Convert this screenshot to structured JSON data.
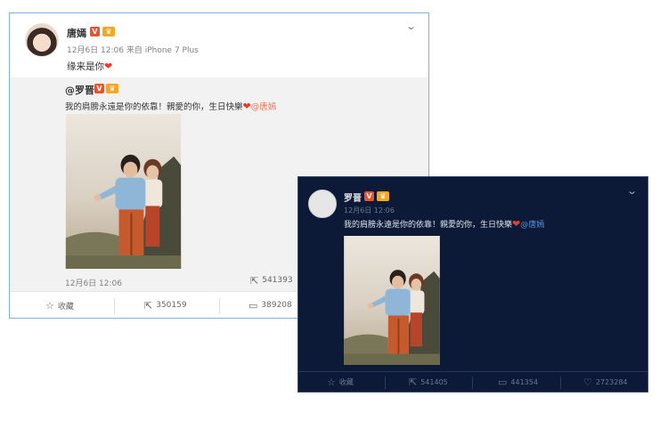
{
  "light_card": {
    "username": "唐嫣",
    "verified_badge": "V",
    "meta": "12月6日 12:06 来自 iPhone 7 Plus",
    "text": "缘来是你",
    "repost": {
      "username": "@罗晋",
      "text": "我的肩膀永遠是你的依靠！親愛的你，生日快樂",
      "mention": "@唐嫣",
      "date": "12月6日 12:06",
      "count": "541393"
    },
    "actions": [
      {
        "icon": "star-icon",
        "label": "收藏"
      },
      {
        "icon": "share-icon",
        "label": "350159"
      },
      {
        "icon": "comment-icon",
        "label": "389208"
      }
    ]
  },
  "dark_card": {
    "username": "罗晋",
    "verified_badge": "V",
    "meta": "12月6日 12:06",
    "text": "我的肩膀永遠是你的依靠！親愛的你，生日快樂",
    "mention": "@唐嫣",
    "actions": [
      {
        "icon": "star-icon",
        "label": "收藏"
      },
      {
        "icon": "share-icon",
        "label": "541405"
      },
      {
        "icon": "comment-icon",
        "label": "441354"
      },
      {
        "icon": "like-icon",
        "label": "2723284"
      }
    ]
  },
  "colors": {
    "light_border": "#7fb0de",
    "dark_bg": "#0c1a38",
    "link": "#eb7350",
    "heart": "#e83d2a"
  }
}
